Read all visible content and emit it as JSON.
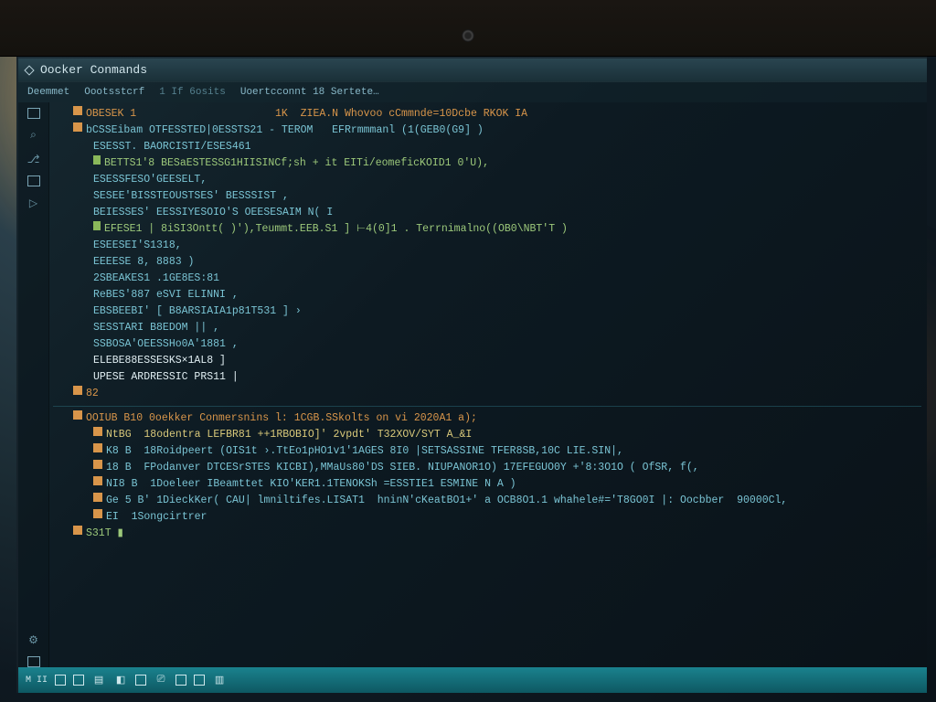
{
  "title": "Oocker Conmands",
  "breadcrumb": {
    "a": "Deemmet",
    "b": "Oootsstcrf",
    "c": "1  If 6osits",
    "d": "Uoertcconnt 18 Sertete…"
  },
  "code_top": [
    {
      "mark": "orange",
      "cls": "c-orange",
      "indent": 1,
      "text": "OBESEK 1                      1K  ZIEA.N Whovoo cCmmnde=10Dcbe RKOK IA"
    },
    {
      "mark": "orange",
      "cls": "c-teal",
      "indent": 1,
      "text": "bCSSEibam OTFESSTED|0ESSTS21 - TEROM   EFRrmmmanl (1(GEB0(G9] )"
    },
    {
      "mark": "",
      "cls": "c-teal",
      "indent": 2,
      "text": "ESESST. BAORCISTI/ESES461"
    },
    {
      "mark": "green",
      "cls": "c-green",
      "indent": 2,
      "text": "BETTS1'8 BESaESTESSG1HIISINCf;sh + it EITi/eomeficKOID1 0'U),"
    },
    {
      "mark": "",
      "cls": "c-teal",
      "indent": 2,
      "text": "ESESSFESO'GEESELT,"
    },
    {
      "mark": "",
      "cls": "c-teal",
      "indent": 2,
      "text": "SESEE'BISSTEOUSTSES' BESSSIST ,"
    },
    {
      "mark": "",
      "cls": "c-teal",
      "indent": 2,
      "text": "BEIESSES' EESSIYESOIO'S OEESESAIM N( I"
    },
    {
      "mark": "green",
      "cls": "c-green",
      "indent": 2,
      "text": "EFESE1 | 8iSI3Ontt( )'),Teummt.EEB.S1 ] ⊢4(0]1 . Terrnimalno((OB0\\NBT'T )"
    },
    {
      "mark": "",
      "cls": "c-teal",
      "indent": 2,
      "text": "ESEESEI'S1318,"
    },
    {
      "mark": "",
      "cls": "c-teal",
      "indent": 2,
      "text": "EEEESE 8, 8883 )"
    },
    {
      "mark": "",
      "cls": "c-teal",
      "indent": 2,
      "text": "2SBEAKES1 .1GE8ES:81"
    },
    {
      "mark": "",
      "cls": "c-teal",
      "indent": 2,
      "text": "ReBES'887 eSVI ELINNI ,"
    },
    {
      "mark": "",
      "cls": "c-teal",
      "indent": 2,
      "text": "EBSBEEBI' [ B8ARSIAIA1p81T531 ] ›"
    },
    {
      "mark": "",
      "cls": "c-teal",
      "indent": 2,
      "text": "SESSTARI B8EDOM || ,"
    },
    {
      "mark": "",
      "cls": "c-teal",
      "indent": 2,
      "text": "SSBOSA'OEESSHo0A'1881 ,"
    },
    {
      "mark": "",
      "cls": "c-white",
      "indent": 2,
      "text": "ELEBE88ESSESKS×1AL8 ]"
    },
    {
      "mark": "",
      "cls": "c-white",
      "indent": 2,
      "text": "UPESE ARDRESSIC PRS11 |"
    },
    {
      "mark": "orange",
      "cls": "c-orange",
      "indent": 1,
      "text": "82"
    }
  ],
  "code_bottom": [
    {
      "mark": "orange",
      "cls": "c-orange",
      "indent": 1,
      "text": "OOIUB B10 0oekker Conmersnins l: 1CGB.SSkolts on vi 2020A1 a);"
    },
    {
      "mark": "orange",
      "cls": "c-yellow",
      "indent": 2,
      "text": "NtBG  18odentra LEFBR81 ++1RBOBIO]' 2vpdt' T32XOV/SYT A_&I"
    },
    {
      "mark": "orange",
      "cls": "c-teal",
      "indent": 2,
      "text": "K8 B  18Roidpeert (OIS1t ›.TtEo1pHO1v1'1AGES 8I0 |SETSASSINE TFER8SB,10C LIE.SIN|,"
    },
    {
      "mark": "orange",
      "cls": "c-teal",
      "indent": 2,
      "text": "18 B  FPodanver DTCESrSTES KICBI),MMaUs80'DS SIEB. NIUPANOR1O) 17EFEGUO0Y +'8:3O1O ( OfSR, f(,"
    },
    {
      "mark": "orange",
      "cls": "c-teal",
      "indent": 2,
      "text": "NI8 B  1Doeleer IBeamttet KIO'KER1.1TENOKSh =ESSTIE1 ESMINE N A )"
    },
    {
      "mark": "orange",
      "cls": "c-teal",
      "indent": 2,
      "text": "Ge 5 B' 1DieckKer( CAU| lmniltifes.LISAT1  hninN'cKeatBO1+' a OCB8O1.1 whahele#='T8GO0I |: Oocbber  90000Cl,"
    },
    {
      "mark": "orange",
      "cls": "c-teal",
      "indent": 2,
      "text": "EI  1Songcirtrer "
    },
    {
      "mark": "orange",
      "cls": "c-green",
      "indent": 1,
      "text": "S31T ▮"
    }
  ],
  "taskbar": {
    "label": "M II"
  }
}
